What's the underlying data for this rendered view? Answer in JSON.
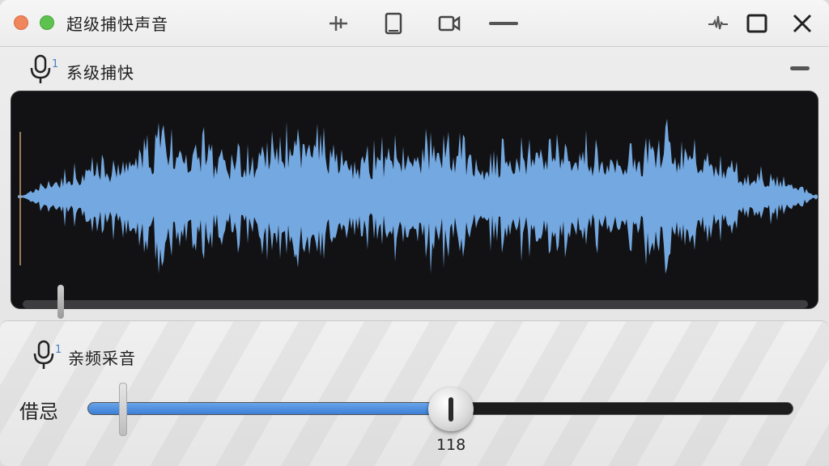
{
  "window": {
    "title": "超级捕快声音",
    "toolbar_icons": [
      "split-icon",
      "tablet-icon",
      "video-camera-icon",
      "minus-icon"
    ],
    "controls": [
      "waveform-pin-icon",
      "maximize-icon",
      "close-icon"
    ]
  },
  "system_capture": {
    "icon": "microphone-icon",
    "badge": "1",
    "label": "系级捕快"
  },
  "mic_input": {
    "icon": "microphone-icon",
    "badge": "1",
    "label": "亲频采音",
    "slider_label": "借忌",
    "slider_value_text": "118",
    "slider_fraction": 0.515
  },
  "colors": {
    "waveform": "#74a8e0",
    "accent": "#3c7fd6",
    "panel": "#121214"
  }
}
